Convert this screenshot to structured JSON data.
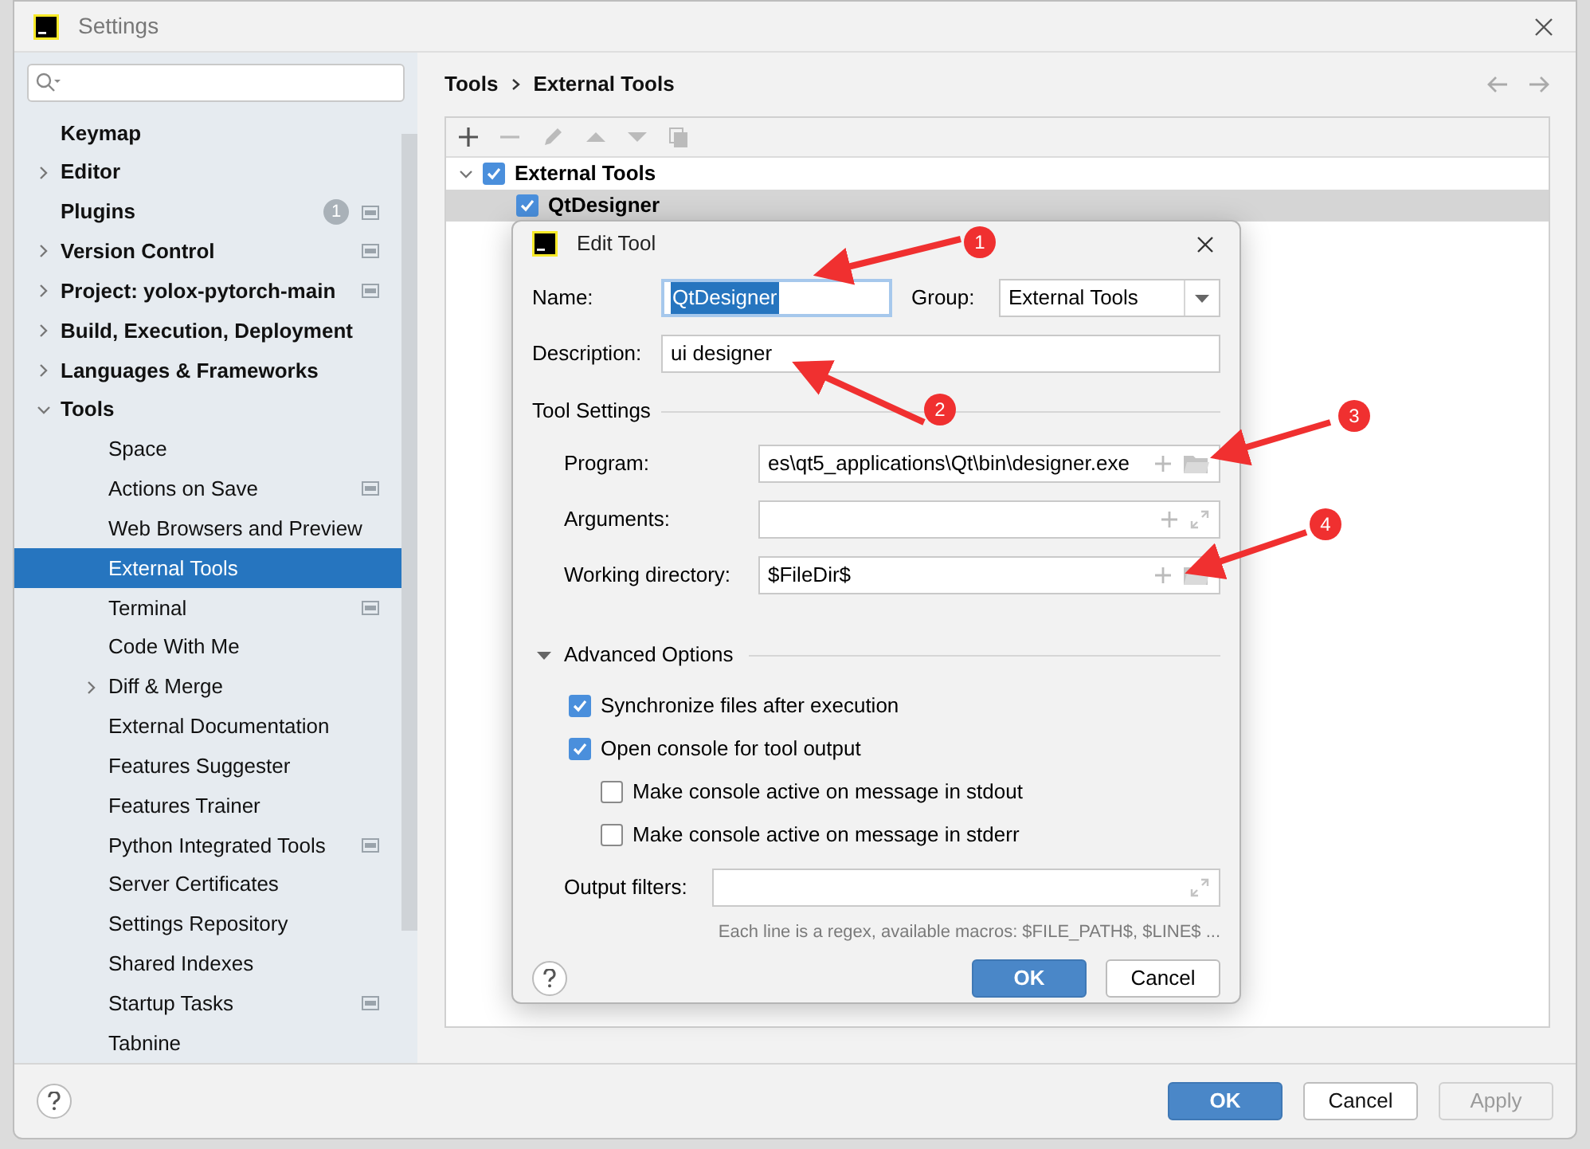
{
  "window": {
    "title": "Settings"
  },
  "sidebar": {
    "items": [
      {
        "label": "Keymap",
        "bold": true,
        "expandable": false,
        "selected": false,
        "project_icon": false
      },
      {
        "label": "Editor",
        "bold": true,
        "expandable": true,
        "expanded": false,
        "selected": false,
        "project_icon": false
      },
      {
        "label": "Plugins",
        "bold": true,
        "expandable": false,
        "selected": false,
        "project_icon": true,
        "badge": "1"
      },
      {
        "label": "Version Control",
        "bold": true,
        "expandable": true,
        "expanded": false,
        "selected": false,
        "project_icon": true
      },
      {
        "label": "Project: yolox-pytorch-main",
        "bold": true,
        "expandable": true,
        "expanded": false,
        "selected": false,
        "project_icon": true
      },
      {
        "label": "Build, Execution, Deployment",
        "bold": true,
        "expandable": true,
        "expanded": false,
        "selected": false,
        "project_icon": false
      },
      {
        "label": "Languages & Frameworks",
        "bold": true,
        "expandable": true,
        "expanded": false,
        "selected": false,
        "project_icon": false
      },
      {
        "label": "Tools",
        "bold": true,
        "expandable": true,
        "expanded": true,
        "selected": false,
        "project_icon": false,
        "children": [
          {
            "label": "Space",
            "expandable": false,
            "selected": false,
            "project_icon": false
          },
          {
            "label": "Actions on Save",
            "expandable": false,
            "selected": false,
            "project_icon": true
          },
          {
            "label": "Web Browsers and Preview",
            "expandable": false,
            "selected": false,
            "project_icon": false
          },
          {
            "label": "External Tools",
            "expandable": false,
            "selected": true,
            "project_icon": false
          },
          {
            "label": "Terminal",
            "expandable": false,
            "selected": false,
            "project_icon": true
          },
          {
            "label": "Code With Me",
            "expandable": false,
            "selected": false,
            "project_icon": false
          },
          {
            "label": "Diff & Merge",
            "expandable": true,
            "expanded": false,
            "selected": false,
            "project_icon": false
          },
          {
            "label": "External Documentation",
            "expandable": false,
            "selected": false,
            "project_icon": false
          },
          {
            "label": "Features Suggester",
            "expandable": false,
            "selected": false,
            "project_icon": false
          },
          {
            "label": "Features Trainer",
            "expandable": false,
            "selected": false,
            "project_icon": false
          },
          {
            "label": "Python Integrated Tools",
            "expandable": false,
            "selected": false,
            "project_icon": true
          },
          {
            "label": "Server Certificates",
            "expandable": false,
            "selected": false,
            "project_icon": false
          },
          {
            "label": "Settings Repository",
            "expandable": false,
            "selected": false,
            "project_icon": false
          },
          {
            "label": "Shared Indexes",
            "expandable": false,
            "selected": false,
            "project_icon": false
          },
          {
            "label": "Startup Tasks",
            "expandable": false,
            "selected": false,
            "project_icon": true
          },
          {
            "label": "Tabnine",
            "expandable": false,
            "selected": false,
            "project_icon": false
          }
        ]
      }
    ]
  },
  "breadcrumb": [
    "Tools",
    "External Tools"
  ],
  "tree": [
    {
      "label": "External Tools",
      "checked": true,
      "expanded": true,
      "selected": false,
      "children": [
        {
          "label": "QtDesigner",
          "checked": true,
          "selected": true
        }
      ]
    }
  ],
  "dialog": {
    "title": "Edit Tool",
    "name_label": "Name:",
    "name_value": "QtDesigner",
    "group_label": "Group:",
    "group_value": "External Tools",
    "description_label": "Description:",
    "description_value": "ui designer",
    "tool_settings": "Tool Settings",
    "fields": [
      {
        "label": "Program:",
        "value": "es\\qt5_applications\\Qt\\bin\\designer.exe",
        "kind": "browse"
      },
      {
        "label": "Arguments:",
        "kind": "expand"
      },
      {
        "label": "Working directory:",
        "value": "$FileDir$",
        "kind": "browse"
      }
    ],
    "advanced": {
      "label": "Advanced Options",
      "expanded": true
    },
    "options": [
      {
        "label": "Synchronize files after execution",
        "checked": true,
        "nested": false
      },
      {
        "label": "Open console for tool output",
        "checked": true,
        "nested": false
      },
      {
        "label": "Make console active on message in stdout",
        "checked": false,
        "nested": true
      },
      {
        "label": "Make console active on message in stderr",
        "checked": false,
        "nested": true
      }
    ],
    "output_filters_label": "Output filters:",
    "hint": "Each line is a regex, available macros: $FILE_PATH$, $LINE$ ...",
    "ok": "OK",
    "cancel": "Cancel"
  },
  "annotations": [
    "1",
    "2",
    "3",
    "4"
  ],
  "buttons": [
    {
      "label": "OK",
      "kind": "primary",
      "disabled": false
    },
    {
      "label": "Cancel",
      "kind": "normal",
      "disabled": false
    },
    {
      "label": "Apply",
      "kind": "normal",
      "disabled": true
    }
  ]
}
